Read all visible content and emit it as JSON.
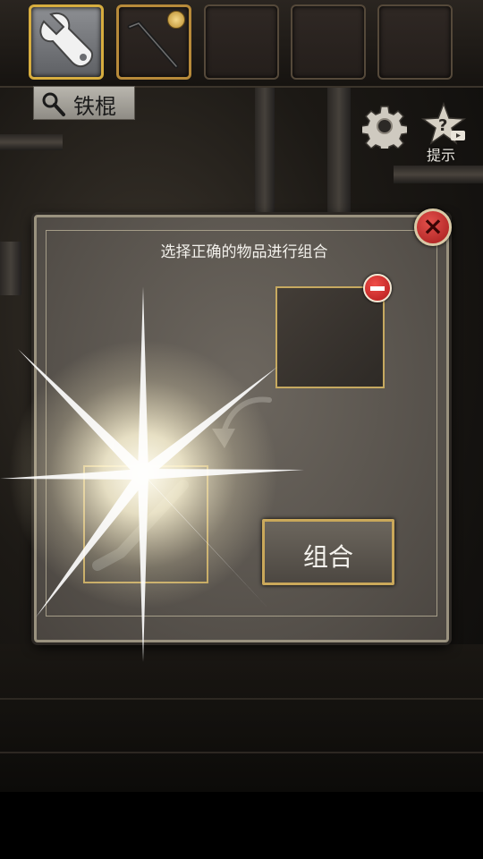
{
  "inventory": {
    "slots": [
      {
        "item_icon": "wrench-icon",
        "state": "selected"
      },
      {
        "item_icon": "iron-rod-icon",
        "state": "filled",
        "badge_icon": "wrench-badge-icon"
      },
      {
        "item_icon": "",
        "state": "empty"
      },
      {
        "item_icon": "",
        "state": "empty"
      },
      {
        "item_icon": "",
        "state": "empty"
      }
    ],
    "selected_item_name": "铁棍",
    "label_icon": "magnifier-icon"
  },
  "toolbar": {
    "settings_icon": "gear-icon",
    "hint_icon": "star-question-icon",
    "hint_label": "提示"
  },
  "combine_dialog": {
    "title": "选择正确的物品进行组合",
    "close_icon": "close-icon",
    "remove_icon": "minus-icon",
    "combine_label": "组合",
    "arrow_icon": "curved-arrow-icon",
    "flash_icon": "light-burst-icon"
  },
  "colors": {
    "accent_gold": "#c6a960",
    "close_red": "#c12a26",
    "dialog_bg": "#5b5650"
  }
}
